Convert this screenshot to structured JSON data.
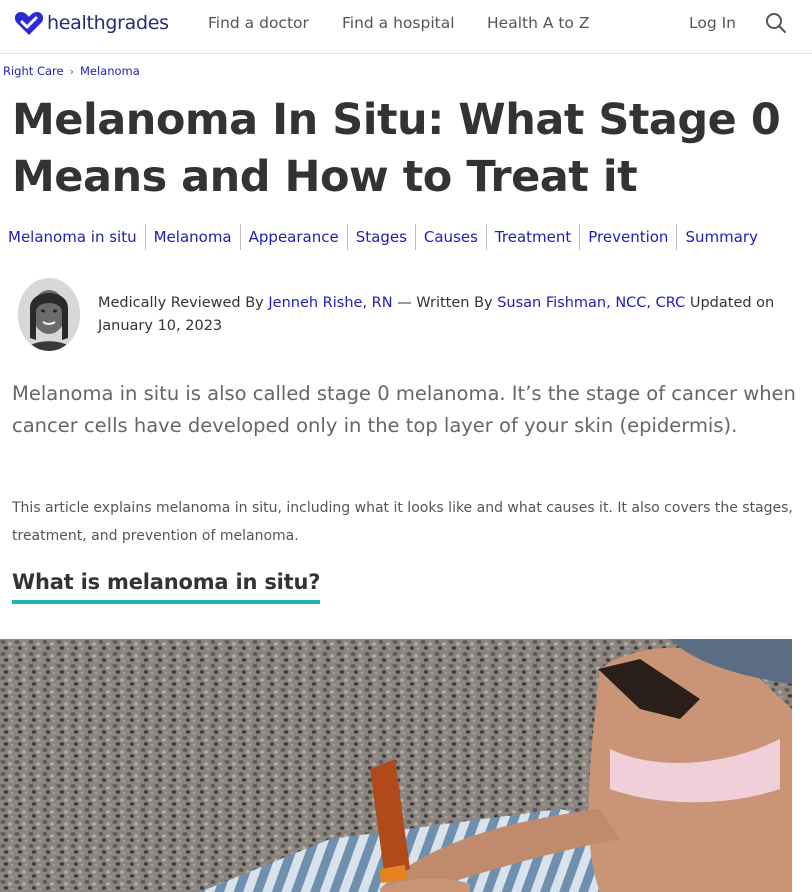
{
  "brand": {
    "name": "healthgrades",
    "color": "#2a2a72",
    "heart_color": "#2a2ad6"
  },
  "nav": {
    "items": [
      "Find a doctor",
      "Find a hospital",
      "Health A to Z"
    ],
    "login": "Log In"
  },
  "breadcrumb": {
    "items": [
      "Right Care",
      "Melanoma"
    ]
  },
  "article": {
    "title": "Melanoma In Situ: What Stage 0 Means and How to Treat it",
    "sections": [
      "Melanoma in situ",
      "Melanoma",
      "Appearance",
      "Stages",
      "Causes",
      "Treatment",
      "Prevention",
      "Summary"
    ],
    "byline": {
      "reviewed_prefix": "Medically Reviewed By ",
      "reviewer": "Jenneh Rishe, RN",
      "written_prefix": " — Written By ",
      "writer": "Susan Fishman, NCC, CRC",
      "updated": " Updated on January 10, 2023"
    },
    "lead": "Melanoma in situ is also called stage 0 melanoma. It’s the stage of cancer when cancer cells have developed only in the top layer of your skin (epidermis).",
    "intro": "This article explains melanoma in situ, including what it looks like and what causes it. It also covers the stages, treatment, and prevention of melanoma.",
    "heading": "What is melanoma in situ?"
  },
  "colors": {
    "link": "#1e1eb4",
    "accent_underline": "#24b3b3"
  }
}
